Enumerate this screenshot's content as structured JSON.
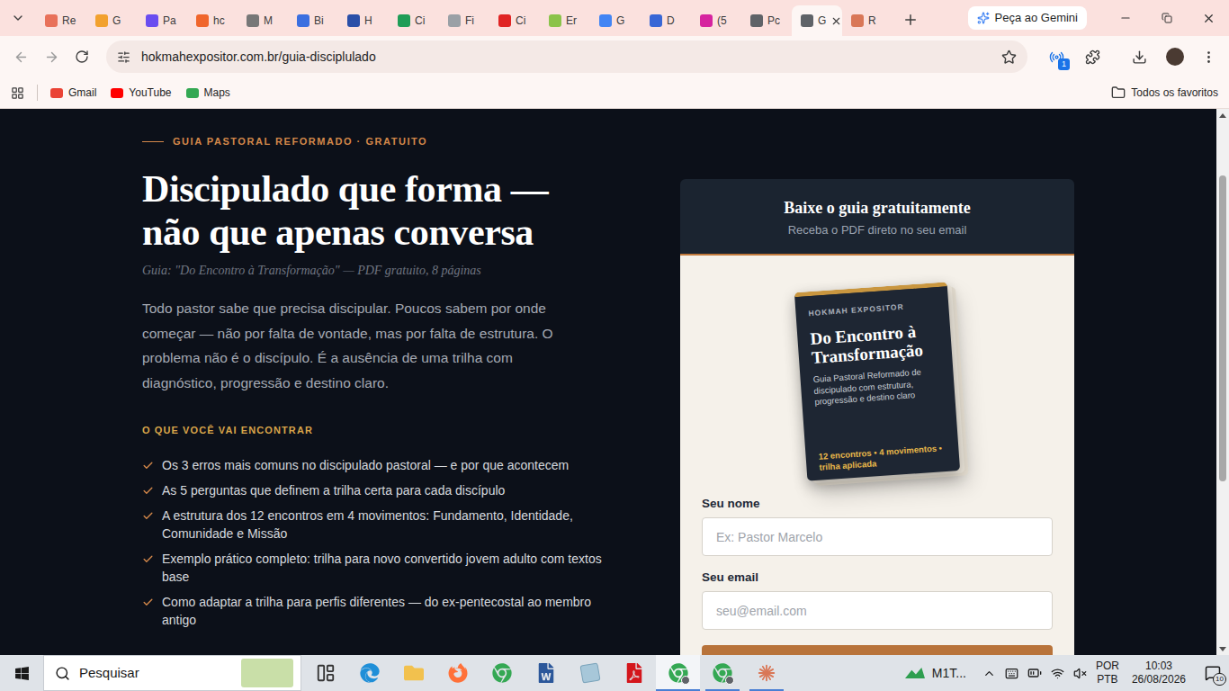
{
  "browser": {
    "tabs": [
      {
        "label": "Re",
        "color": "#e8715a",
        "selected": false
      },
      {
        "label": "G",
        "color": "#f2a12e",
        "selected": false
      },
      {
        "label": "Pa",
        "color": "#6a4df0",
        "selected": false
      },
      {
        "label": "hc",
        "color": "#f0662c",
        "selected": false
      },
      {
        "label": "M",
        "color": "#777777",
        "selected": false
      },
      {
        "label": "Bi",
        "color": "#3b6fe0",
        "selected": false
      },
      {
        "label": "H",
        "color": "#2a4fa8",
        "selected": false
      },
      {
        "label": "Ci",
        "color": "#1f9d57",
        "selected": false
      },
      {
        "label": "Fi",
        "color": "#9aa0a6",
        "selected": false
      },
      {
        "label": "Ci",
        "color": "#e02424",
        "selected": false
      },
      {
        "label": "Er",
        "color": "#8bc34a",
        "selected": false
      },
      {
        "label": "G",
        "color": "#4285f4",
        "selected": false
      },
      {
        "label": "D",
        "color": "#3867d6",
        "selected": false
      },
      {
        "label": "(5",
        "color": "#d6249f",
        "selected": false
      },
      {
        "label": "Pc",
        "color": "#5f6368",
        "selected": false
      },
      {
        "label": "G",
        "color": "#5f6368",
        "selected": true
      },
      {
        "label": "R",
        "color": "#d97757",
        "selected": false
      }
    ],
    "gemini_button": "Peça ao Gemini",
    "url": "hokmahexpositor.com.br/guia-disciplulado",
    "extension_badge": "1",
    "bookmarks": [
      {
        "label": "Gmail",
        "color": "#ea4335"
      },
      {
        "label": "YouTube",
        "color": "#ff0000"
      },
      {
        "label": "Maps",
        "color": "#34a853"
      }
    ],
    "all_bookmarks": "Todos os favoritos"
  },
  "page": {
    "eyebrow": "GUIA PASTORAL REFORMADO · GRATUITO",
    "title_lines": [
      "Discipulado que forma —",
      "não que apenas conversa"
    ],
    "subtitle": "Guia: \"Do Encontro à Transformação\" — PDF gratuito, 8 páginas",
    "intro": "Todo pastor sabe que precisa discipular. Poucos sabem por onde começar — não por falta de vontade, mas por falta de estrutura. O problema não é o discípulo. É a ausência de uma trilha com diagnóstico, progressão e destino claro.",
    "section_label": "O QUE VOCÊ VAI ENCONTRAR",
    "items": [
      "Os 3 erros mais comuns no discipulado pastoral — e por que acontecem",
      "As 5 perguntas que definem a trilha certa para cada discípulo",
      "A estrutura dos 12 encontros em 4 movimentos: Fundamento, Identidade, Comunidade e Missão",
      "Exemplo prático completo: trilha para novo convertido jovem adulto com textos base",
      "Como adaptar a trilha para perfis diferentes — do ex-pentecostal ao membro antigo"
    ]
  },
  "signup_card": {
    "title": "Baixe o guia gratuitamente",
    "subtitle": "Receba o PDF direto no seu email",
    "book": {
      "brand": "HOKMAH EXPOSITOR",
      "title": "Do Encontro à Transformação",
      "description": "Guia Pastoral Reformado de discipulado com estrutura, progressão e destino claro",
      "footer": "12 encontros • 4 movimentos • trilha aplicada"
    },
    "fields": [
      {
        "label": "Seu nome",
        "placeholder": "Ex: Pastor Marcelo"
      },
      {
        "label": "Seu email",
        "placeholder": "seu@email.com"
      }
    ]
  },
  "taskbar": {
    "search_placeholder": "Pesquisar",
    "apps": [
      {
        "kind": "task-view",
        "running": false,
        "selected": false
      },
      {
        "kind": "edge",
        "running": false,
        "selected": false
      },
      {
        "kind": "folder",
        "running": false,
        "selected": false
      },
      {
        "kind": "firefox",
        "running": false,
        "selected": false
      },
      {
        "kind": "chrome",
        "running": false,
        "selected": false
      },
      {
        "kind": "word",
        "running": false,
        "selected": false
      },
      {
        "kind": "notes",
        "running": false,
        "selected": false
      },
      {
        "kind": "acrobat",
        "running": false,
        "selected": false
      },
      {
        "kind": "chrome-profile",
        "running": true,
        "selected": true
      },
      {
        "kind": "chrome-profile",
        "running": true,
        "selected": false
      },
      {
        "kind": "claude",
        "running": true,
        "selected": false
      }
    ],
    "tray_app": "M1T...",
    "language": "POR",
    "layout": "PTB",
    "time": "10:03",
    "date": "26/08/2026",
    "notifications": "10"
  }
}
